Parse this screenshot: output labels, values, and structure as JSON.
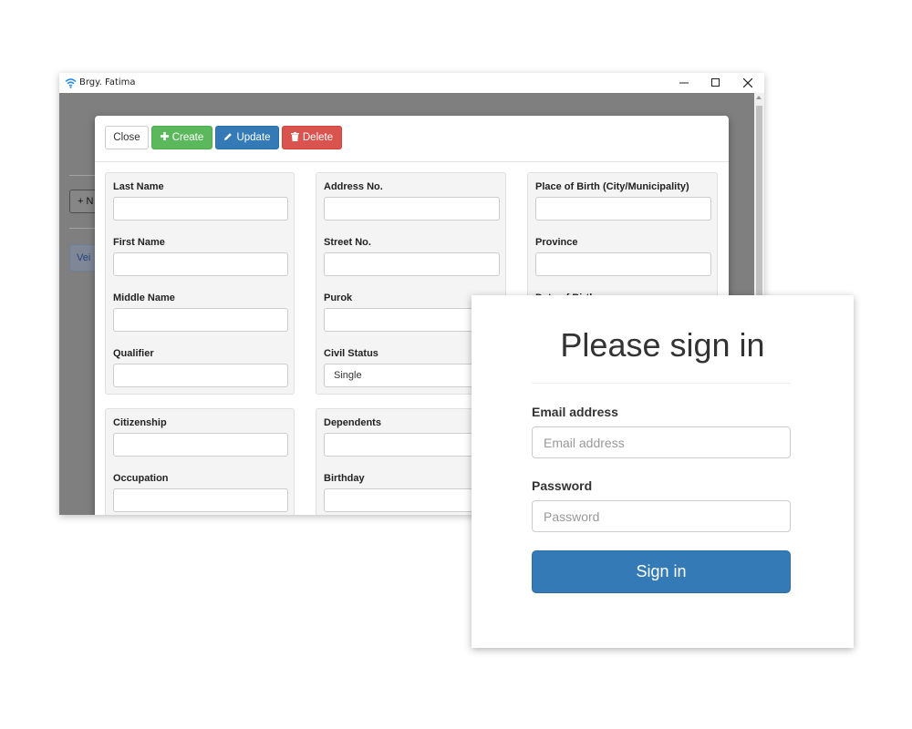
{
  "window": {
    "title": "Brgy. Fatima",
    "minimize_glyph": "–",
    "maximize_glyph": "☐",
    "close_glyph": "✕"
  },
  "background": {
    "new_button_label": "+ N",
    "view_button_label": "Vei"
  },
  "toolbar": {
    "close_label": "Close",
    "create_label": "Create",
    "update_label": "Update",
    "delete_label": "Delete"
  },
  "form": {
    "col1": {
      "last_name": {
        "label": "Last Name",
        "value": ""
      },
      "first_name": {
        "label": "First Name",
        "value": ""
      },
      "middle_name": {
        "label": "Middle Name",
        "value": ""
      },
      "qualifier": {
        "label": "Qualifier",
        "value": ""
      },
      "citizenship": {
        "label": "Citizenship",
        "value": ""
      },
      "occupation": {
        "label": "Occupation",
        "value": ""
      }
    },
    "col2": {
      "address_no": {
        "label": "Address No.",
        "value": ""
      },
      "street_no": {
        "label": "Street No.",
        "value": ""
      },
      "purok": {
        "label": "Purok",
        "value": ""
      },
      "civil_status": {
        "label": "Civil Status",
        "value": "Single"
      },
      "dependents": {
        "label": "Dependents",
        "value": ""
      },
      "birthday": {
        "label": "Birthday",
        "value": ""
      }
    },
    "col3": {
      "place_of_birth": {
        "label": "Place of Birth (City/Municipality)",
        "value": ""
      },
      "province": {
        "label": "Province",
        "value": ""
      },
      "date_of_birth": {
        "label": "Date of Birth"
      }
    }
  },
  "signin": {
    "heading": "Please sign in",
    "email_label": "Email address",
    "email_placeholder": "Email address",
    "password_label": "Password",
    "password_placeholder": "Password",
    "button_label": "Sign in"
  },
  "colors": {
    "primary": "#337ab7",
    "success": "#5cb85c",
    "danger": "#d9534f",
    "wifi": "#1e88e5"
  }
}
